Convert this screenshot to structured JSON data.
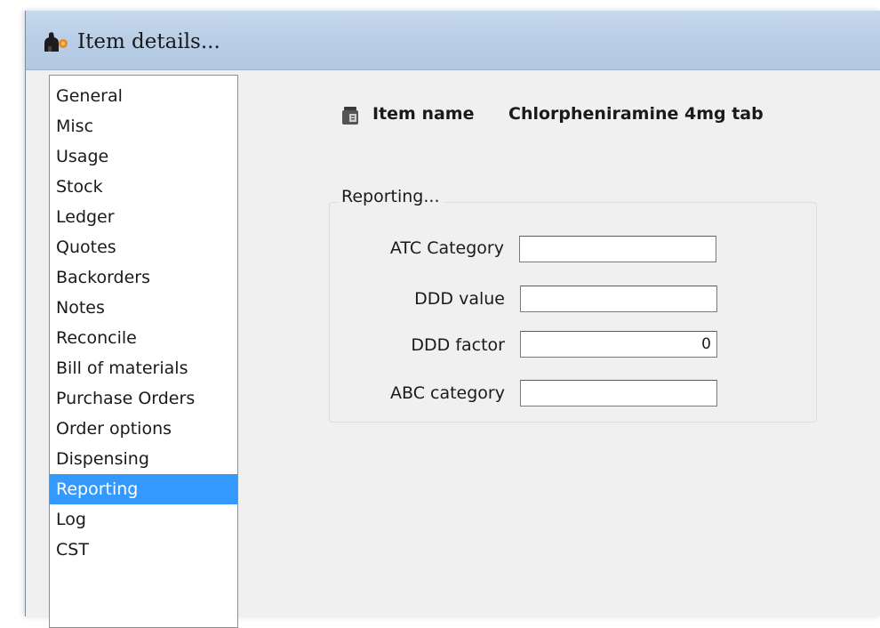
{
  "window": {
    "title": "Item details..."
  },
  "sidebar": {
    "items": [
      {
        "label": "General"
      },
      {
        "label": "Misc"
      },
      {
        "label": "Usage"
      },
      {
        "label": "Stock"
      },
      {
        "label": "Ledger"
      },
      {
        "label": "Quotes"
      },
      {
        "label": "Backorders"
      },
      {
        "label": "Notes"
      },
      {
        "label": "Reconcile"
      },
      {
        "label": "Bill of materials"
      },
      {
        "label": "Purchase Orders"
      },
      {
        "label": "Order options"
      },
      {
        "label": "Dispensing"
      },
      {
        "label": "Reporting",
        "selected": true
      },
      {
        "label": "Log"
      },
      {
        "label": "CST"
      }
    ],
    "selected_color": "#3399ff"
  },
  "item": {
    "name_label": "Item name",
    "name_value": "Chlorpheniramine 4mg tab"
  },
  "reporting": {
    "group_title": "Reporting...",
    "fields": [
      {
        "label": "ATC Category",
        "value": ""
      },
      {
        "label": "DDD value",
        "value": ""
      },
      {
        "label": "DDD factor",
        "value": "0"
      },
      {
        "label": "ABC category",
        "value": ""
      }
    ]
  },
  "icons": {
    "title_icon": "mSupply-app-icon",
    "item_icon": "item-bottle-icon"
  }
}
